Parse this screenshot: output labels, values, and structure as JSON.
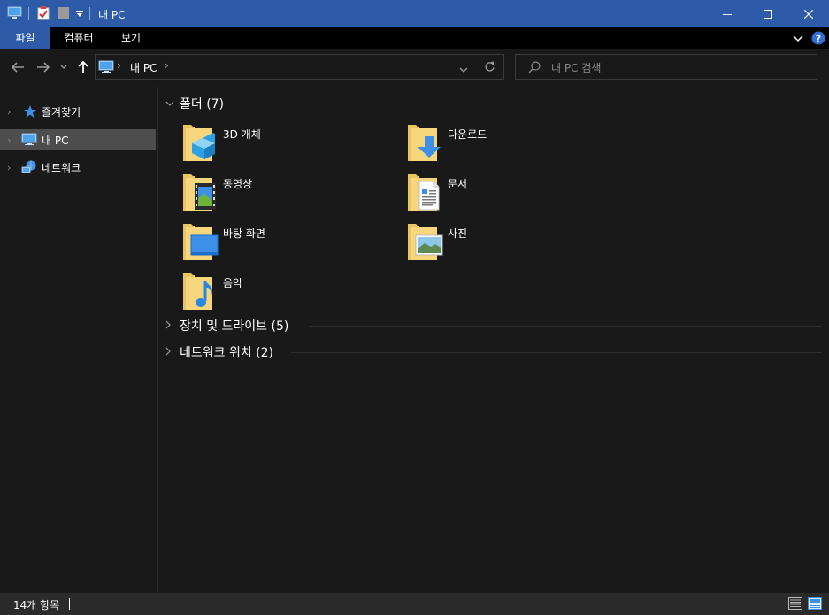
{
  "window": {
    "title": "내 PC"
  },
  "ribbon": {
    "tabs": [
      {
        "label": "파일",
        "active": true
      },
      {
        "label": "컴퓨터",
        "active": false
      },
      {
        "label": "보기",
        "active": false
      }
    ]
  },
  "address": {
    "segments": [
      "내 PC"
    ]
  },
  "search": {
    "placeholder": "내 PC 검색"
  },
  "navigation": {
    "items": [
      {
        "label": "즐겨찾기",
        "icon": "star-icon"
      },
      {
        "label": "내 PC",
        "icon": "computer-icon",
        "selected": true
      },
      {
        "label": "네트워크",
        "icon": "network-icon"
      }
    ]
  },
  "groups": {
    "folders": {
      "title": "폴더 (7)",
      "items": [
        {
          "label": "3D 개체",
          "icon": "3d-objects-folder-icon"
        },
        {
          "label": "다운로드",
          "icon": "downloads-folder-icon"
        },
        {
          "label": "동영상",
          "icon": "videos-folder-icon"
        },
        {
          "label": "문서",
          "icon": "documents-folder-icon"
        },
        {
          "label": "바탕 화면",
          "icon": "desktop-folder-icon"
        },
        {
          "label": "사진",
          "icon": "pictures-folder-icon"
        },
        {
          "label": "음악",
          "icon": "music-folder-icon"
        }
      ]
    },
    "drives": {
      "title": "장치 및 드라이브 (5)"
    },
    "network": {
      "title": "네트워크 위치 (2)"
    }
  },
  "status": {
    "count": "14개 항목"
  },
  "colors": {
    "accent": "#2d5ba8",
    "selection": "#4d4d4d",
    "background": "#191919",
    "folder": "#f5d67d"
  }
}
